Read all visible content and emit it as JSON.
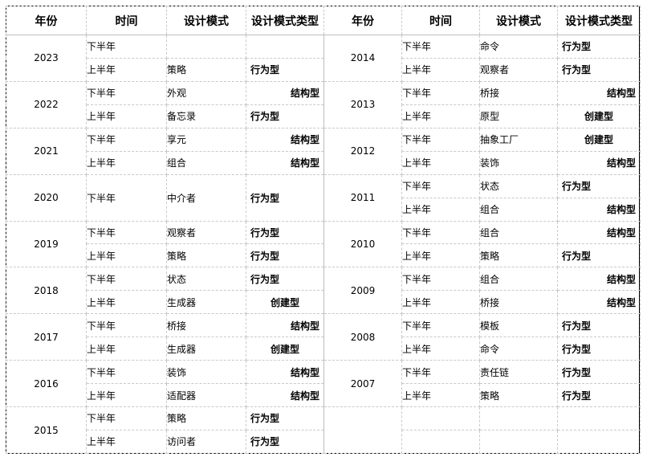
{
  "headers": [
    "年份",
    "时间",
    "设计模式",
    "设计模式类型",
    "年份",
    "时间",
    "设计模式",
    "设计模式类型"
  ],
  "colors": {
    "behavioral": "#c00000",
    "structural": "#0070c0",
    "creational": "#00a050"
  },
  "left": {
    "years": [
      {
        "year": "2023",
        "rows": [
          {
            "half": "下半年",
            "pattern": "",
            "type": "",
            "kind": ""
          },
          {
            "half": "上半年",
            "pattern": "策略",
            "type": "行为型",
            "kind": "behavioral"
          }
        ]
      },
      {
        "year": "2022",
        "rows": [
          {
            "half": "下半年",
            "pattern": "外观",
            "type": "结构型",
            "kind": "structural"
          },
          {
            "half": "上半年",
            "pattern": "备忘录",
            "type": "行为型",
            "kind": "behavioral"
          }
        ]
      },
      {
        "year": "2021",
        "rows": [
          {
            "half": "下半年",
            "pattern": "享元",
            "type": "结构型",
            "kind": "structural"
          },
          {
            "half": "上半年",
            "pattern": "组合",
            "type": "结构型",
            "kind": "structural"
          }
        ]
      },
      {
        "year": "2020",
        "rows": [
          {
            "half": "下半年",
            "pattern": "中介者",
            "type": "行为型",
            "kind": "behavioral"
          }
        ]
      },
      {
        "year": "2019",
        "rows": [
          {
            "half": "下半年",
            "pattern": "观察者",
            "type": "行为型",
            "kind": "behavioral"
          },
          {
            "half": "上半年",
            "pattern": "策略",
            "type": "行为型",
            "kind": "behavioral"
          }
        ]
      },
      {
        "year": "2018",
        "rows": [
          {
            "half": "下半年",
            "pattern": "状态",
            "type": "行为型",
            "kind": "behavioral"
          },
          {
            "half": "上半年",
            "pattern": "生成器",
            "type": "创建型",
            "kind": "creational"
          }
        ]
      },
      {
        "year": "2017",
        "rows": [
          {
            "half": "下半年",
            "pattern": "桥接",
            "type": "结构型",
            "kind": "structural"
          },
          {
            "half": "上半年",
            "pattern": "生成器",
            "type": "创建型",
            "kind": "creational"
          }
        ]
      },
      {
        "year": "2016",
        "rows": [
          {
            "half": "下半年",
            "pattern": "装饰",
            "type": "结构型",
            "kind": "structural"
          },
          {
            "half": "上半年",
            "pattern": "适配器",
            "type": "结构型",
            "kind": "structural"
          }
        ]
      },
      {
        "year": "2015",
        "rows": [
          {
            "half": "下半年",
            "pattern": "策略",
            "type": "行为型",
            "kind": "behavioral"
          },
          {
            "half": "上半年",
            "pattern": "访问者",
            "type": "行为型",
            "kind": "behavioral"
          }
        ]
      }
    ]
  },
  "right": {
    "years": [
      {
        "year": "2014",
        "rows": [
          {
            "half": "下半年",
            "pattern": "命令",
            "type": "行为型",
            "kind": "behavioral"
          },
          {
            "half": "上半年",
            "pattern": "观察者",
            "type": "行为型",
            "kind": "behavioral"
          }
        ]
      },
      {
        "year": "2013",
        "rows": [
          {
            "half": "下半年",
            "pattern": "桥接",
            "type": "结构型",
            "kind": "structural"
          },
          {
            "half": "上半年",
            "pattern": "原型",
            "type": "创建型",
            "kind": "creational"
          }
        ]
      },
      {
        "year": "2012",
        "rows": [
          {
            "half": "下半年",
            "pattern": "抽象工厂",
            "type": "创建型",
            "kind": "creational"
          },
          {
            "half": "上半年",
            "pattern": "装饰",
            "type": "结构型",
            "kind": "structural"
          }
        ]
      },
      {
        "year": "2011",
        "rows": [
          {
            "half": "下半年",
            "pattern": "状态",
            "type": "行为型",
            "kind": "behavioral"
          },
          {
            "half": "上半年",
            "pattern": "组合",
            "type": "结构型",
            "kind": "structural"
          }
        ]
      },
      {
        "year": "2010",
        "rows": [
          {
            "half": "下半年",
            "pattern": "组合",
            "type": "结构型",
            "kind": "structural"
          },
          {
            "half": "上半年",
            "pattern": "策略",
            "type": "行为型",
            "kind": "behavioral"
          }
        ]
      },
      {
        "year": "2009",
        "rows": [
          {
            "half": "下半年",
            "pattern": "组合",
            "type": "结构型",
            "kind": "structural"
          },
          {
            "half": "上半年",
            "pattern": "桥接",
            "type": "结构型",
            "kind": "structural"
          }
        ]
      },
      {
        "year": "2008",
        "rows": [
          {
            "half": "下半年",
            "pattern": "模板",
            "type": "行为型",
            "kind": "behavioral"
          },
          {
            "half": "上半年",
            "pattern": "命令",
            "type": "行为型",
            "kind": "behavioral"
          }
        ]
      },
      {
        "year": "2007",
        "rows": [
          {
            "half": "下半年",
            "pattern": "责任链",
            "type": "行为型",
            "kind": "behavioral"
          },
          {
            "half": "上半年",
            "pattern": "策略",
            "type": "行为型",
            "kind": "behavioral"
          }
        ]
      }
    ]
  }
}
